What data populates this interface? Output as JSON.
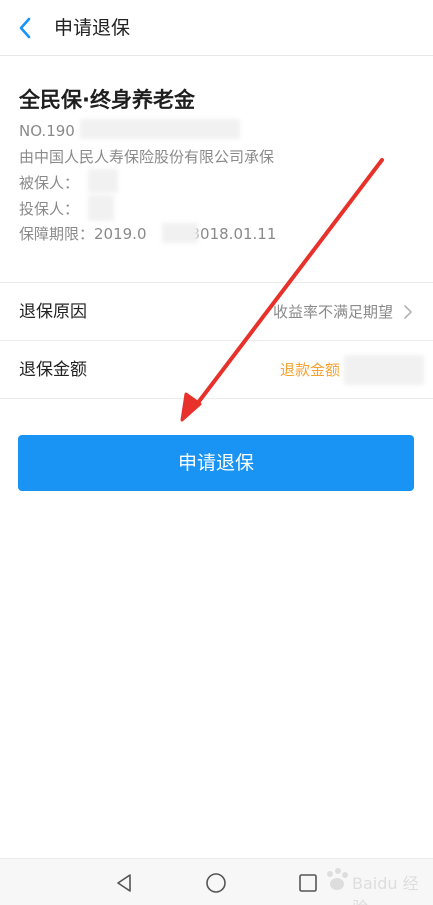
{
  "header": {
    "title": "申请退保"
  },
  "policy": {
    "name": "全民保·终身养老金",
    "number_prefix": "NO.190",
    "insurer": "由中国人民人寿保险股份有限公司承保",
    "insured_label": "被保人：",
    "policyholder_label": "投保人：",
    "coverage_label": "保障期限：2019.0",
    "coverage_end": "3018.01.11"
  },
  "rows": {
    "reason": {
      "label": "退保原因",
      "value": "收益率不满足期望"
    },
    "amount": {
      "label": "退保金额",
      "value": "退款金额"
    }
  },
  "apply_button": {
    "label": "申请退保"
  },
  "watermark": {
    "text": "Baidu 经验"
  },
  "colors": {
    "primary": "#1a94f4",
    "accent_orange": "#f5a232",
    "annotation_red": "#e8312a"
  }
}
